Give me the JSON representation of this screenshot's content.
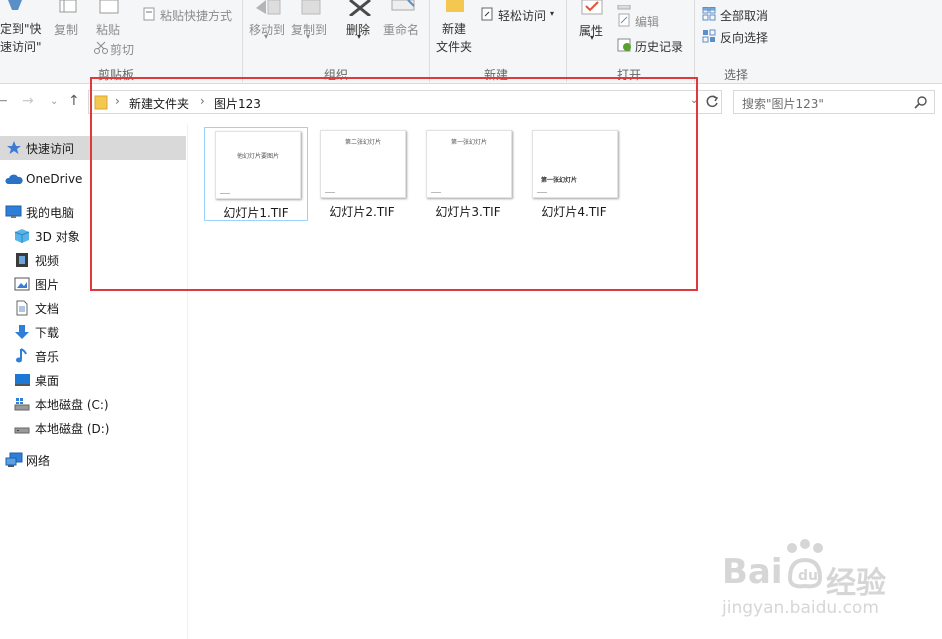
{
  "ribbon": {
    "pin_quick_access_line1": "定到\"快",
    "pin_quick_access_line2": "速访问\"",
    "copy_label": "复制",
    "paste_label": "粘贴",
    "paste_shortcut_label": "粘贴快捷方式",
    "cut_label": "剪切",
    "clipboard_group": "剪贴板",
    "move_to_label": "移动到",
    "copy_to_label": "复制到",
    "delete_label": "删除",
    "rename_label": "重命名",
    "organize_group": "组织",
    "new_folder_line1": "新建",
    "new_folder_line2": "文件夹",
    "easy_access_label": "轻松访问",
    "new_group": "新建",
    "properties_label": "属性",
    "edit_label": "编辑",
    "history_label": "历史记录",
    "open_group": "打开",
    "select_all_label": "全部取消",
    "invert_selection_label": "反向选择",
    "select_group": "选择"
  },
  "address": {
    "breadcrumb": [
      "新建文件夹",
      "图片123"
    ],
    "search_placeholder": "搜索\"图片123\""
  },
  "nav": {
    "items": [
      {
        "label": "快速访问",
        "icon": "star-icon"
      },
      {
        "label": "OneDrive",
        "icon": "cloud-icon"
      },
      {
        "label": "我的电脑",
        "icon": "computer-icon"
      },
      {
        "label": "3D 对象",
        "icon": "cube-icon"
      },
      {
        "label": "视频",
        "icon": "film-icon"
      },
      {
        "label": "图片",
        "icon": "picture-icon"
      },
      {
        "label": "文档",
        "icon": "document-icon"
      },
      {
        "label": "下载",
        "icon": "download-arrow-icon"
      },
      {
        "label": "音乐",
        "icon": "music-note-icon"
      },
      {
        "label": "桌面",
        "icon": "desktop-icon"
      },
      {
        "label": "本地磁盘 (C:)",
        "icon": "drive-c-icon"
      },
      {
        "label": "本地磁盘 (D:)",
        "icon": "drive-d-icon"
      },
      {
        "label": "网络",
        "icon": "network-icon"
      }
    ]
  },
  "files": [
    {
      "name": "幻灯片1.TIF",
      "thumb_text": "他幻灯片要图片"
    },
    {
      "name": "幻灯片2.TIF",
      "thumb_text": "第二张幻灯片"
    },
    {
      "name": "幻灯片3.TIF",
      "thumb_text": "第一张幻灯片"
    },
    {
      "name": "幻灯片4.TIF",
      "thumb_text": "第一张幻灯片"
    }
  ],
  "watermark": {
    "brand_left": "Bai",
    "brand_right": "经验",
    "url": "jingyan.baidu.com"
  },
  "colors": {
    "highlight_box": "#e0393b",
    "selection_border": "#99d1ff",
    "nav_selected": "#d9d9d9"
  }
}
